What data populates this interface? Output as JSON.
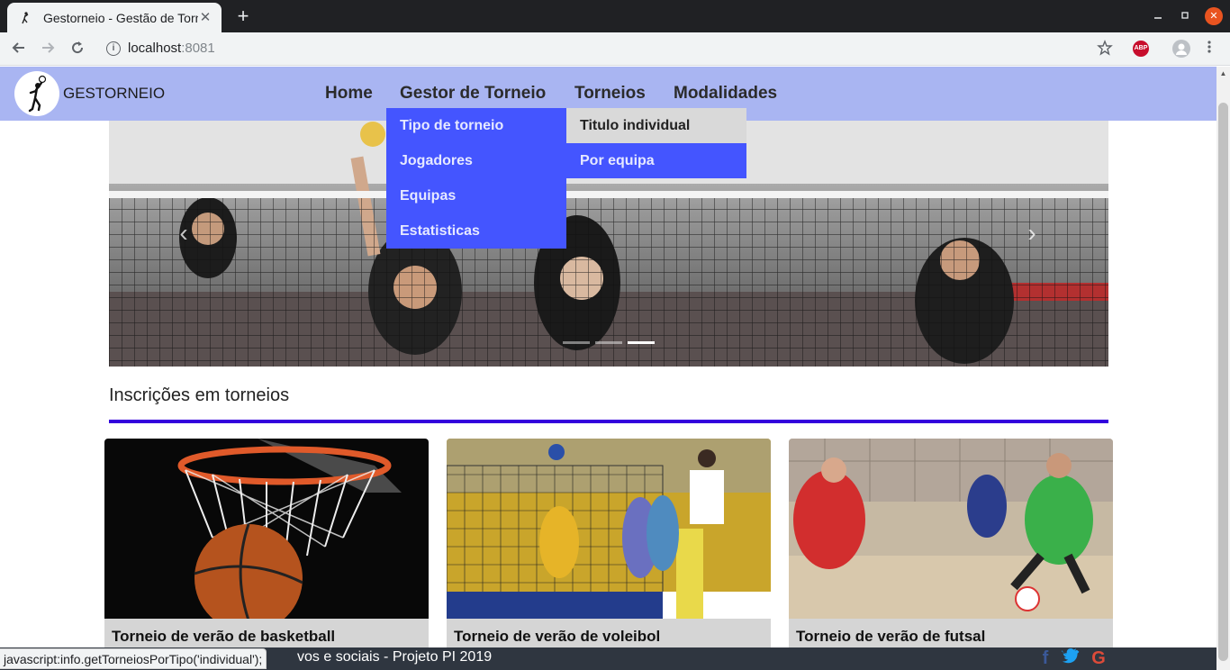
{
  "browser": {
    "tab_title": "Gestorneio - Gestão de Torneios",
    "tab_favicon": "volleyball-player-icon",
    "url_host": "localhost",
    "url_port": ":8081",
    "close_glyph": "✕",
    "new_tab_glyph": "+",
    "extension_badge": "ABP"
  },
  "site": {
    "brand": "GESTORNEIO",
    "nav": [
      "Home",
      "Gestor de Torneio",
      "Torneios",
      "Modalidades"
    ],
    "dropdown_gestor": [
      "Tipo de torneio",
      "Jogadores",
      "Equipas",
      "Estatisticas"
    ],
    "dropdown_torneios": [
      "Titulo individual",
      "Por equipa"
    ],
    "hovered_item": "Titulo individual"
  },
  "carousel": {
    "prev_glyph": "‹",
    "next_glyph": "›",
    "slide_count": 3,
    "active_index": 2
  },
  "section": {
    "title": "Inscrições em torneios"
  },
  "cards": [
    {
      "title": "Torneio de verão de basketball",
      "image": "basketball-hoop-photo"
    },
    {
      "title": "Torneio de verão de voleibol",
      "image": "volleyball-match-photo"
    },
    {
      "title": "Torneio de verão de futsal",
      "image": "futsal-match-photo"
    }
  ],
  "footer": {
    "text_visible": "vos e sociais - Projeto PI 2019",
    "social": [
      "facebook-icon",
      "twitter-icon",
      "google-icon"
    ]
  },
  "status_bar": {
    "link": "javascript:info.getTorneiosPorTipo('individual');"
  },
  "colors": {
    "nav_bg": "#a9b5f2",
    "dropdown_bg": "#4455ff",
    "hover_bg": "#d9d9d9",
    "section_rule": "#3300dd",
    "footer_bg": "#2f3640",
    "facebook": "#3b5998",
    "twitter": "#1da1f2",
    "google": "#dd4b39"
  }
}
